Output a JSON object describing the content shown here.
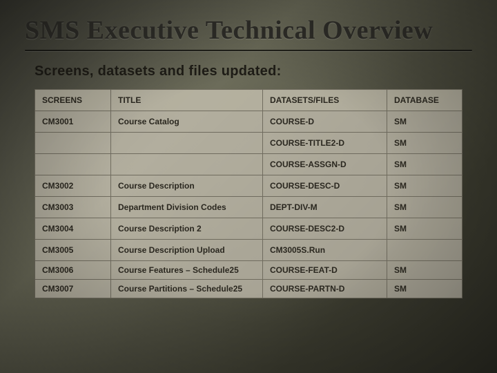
{
  "title": "SMS Executive Technical Overview",
  "subtitle": "Screens, datasets and files updated:",
  "table": {
    "headers": [
      "SCREENS",
      "TITLE",
      "DATASETS/FILES",
      "DATABASE"
    ],
    "rows": [
      {
        "screen": "CM3001",
        "titlecol": "Course Catalog",
        "dataset": "COURSE-D",
        "db": "SM"
      },
      {
        "screen": "",
        "titlecol": "",
        "dataset": "COURSE-TITLE2-D",
        "db": "SM"
      },
      {
        "screen": "",
        "titlecol": "",
        "dataset": "COURSE-ASSGN-D",
        "db": "SM"
      },
      {
        "screen": "CM3002",
        "titlecol": "Course Description",
        "dataset": "COURSE-DESC-D",
        "db": "SM"
      },
      {
        "screen": "CM3003",
        "titlecol": "Department Division Codes",
        "dataset": "DEPT-DIV-M",
        "db": "SM"
      },
      {
        "screen": "CM3004",
        "titlecol": "Course Description 2",
        "dataset": "COURSE-DESC2-D",
        "db": "SM"
      },
      {
        "screen": "CM3005",
        "titlecol": "Course Description Upload",
        "dataset": "CM3005S.Run",
        "db": ""
      },
      {
        "screen": "CM3006",
        "titlecol": "Course Features – Schedule25",
        "dataset": "COURSE-FEAT-D",
        "db": "SM"
      },
      {
        "screen": "CM3007",
        "titlecol": "Course Partitions – Schedule25",
        "dataset": "COURSE-PARTN-D",
        "db": "SM"
      }
    ]
  }
}
